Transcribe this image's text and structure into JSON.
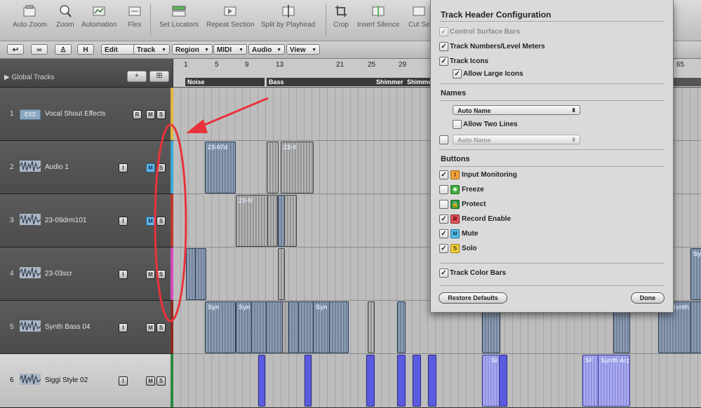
{
  "toolbar": {
    "items": [
      {
        "label": "Auto Zoom",
        "icon": "auto-zoom-icon"
      },
      {
        "label": "Zoom",
        "icon": "zoom-icon"
      },
      {
        "label": "Automation",
        "icon": "automation-icon"
      },
      {
        "label": "Flex",
        "icon": "flex-icon"
      },
      {
        "label": "Set Locators",
        "icon": "set-locators-icon"
      },
      {
        "label": "Repeat Section",
        "icon": "repeat-section-icon"
      },
      {
        "label": "Split by Playhead",
        "icon": "split-playhead-icon"
      },
      {
        "label": "Crop",
        "icon": "crop-icon"
      },
      {
        "label": "Insert Silence",
        "icon": "insert-silence-icon"
      },
      {
        "label": "Cut Se",
        "icon": "cut-section-icon"
      }
    ]
  },
  "menubar": {
    "h_button": "H",
    "menus": [
      "Edit",
      "Track",
      "Region",
      "MIDI",
      "Audio",
      "View"
    ]
  },
  "global_tracks": {
    "label": "Global Tracks",
    "add": "+"
  },
  "ruler": {
    "bars": [
      "1",
      "5",
      "9",
      "13",
      "21",
      "25",
      "29",
      "65"
    ],
    "markers": [
      "Noise",
      "Bass",
      "Shimmer",
      "Shimmer"
    ]
  },
  "tracks": [
    {
      "num": "1",
      "name": "Vocal Shout Effects",
      "icon": "EXS",
      "buttons": [
        "R",
        "M",
        "S"
      ],
      "color": "#e2b83a"
    },
    {
      "num": "2",
      "name": "Audio 1",
      "icon": "waveform",
      "buttons": [
        "I",
        "M",
        "S"
      ],
      "color": "#3aa7d6"
    },
    {
      "num": "3",
      "name": "23-09drm101",
      "icon": "waveform",
      "buttons": [
        "I",
        "M",
        "S"
      ],
      "color": "#c0392b"
    },
    {
      "num": "4",
      "name": "23-03scr",
      "icon": "waveform",
      "buttons": [
        "I",
        "M",
        "S"
      ],
      "color": "#d64bb8"
    },
    {
      "num": "5",
      "name": "Synth Bass 04",
      "icon": "waveform",
      "buttons": [
        "I",
        "M",
        "S"
      ],
      "color": "#8a2b1f"
    },
    {
      "num": "6",
      "name": "Siggi Style 02",
      "icon": "waveform",
      "buttons": [
        "I",
        "M",
        "S"
      ],
      "color": "#2c8a3f"
    }
  ],
  "regions": {
    "r1": "23-07d",
    "r2": "23-0",
    "r3": "23-0!",
    "r4": "Syn",
    "r5": "Syn",
    "r6": "Syn",
    "r7": "Si",
    "r8": "SF",
    "r9": "Synth Arp",
    "r10": "Synth",
    "r11": "Sy"
  },
  "panel": {
    "title": "Track Header Configuration",
    "control_surface_bars": "Control Surface Bars",
    "track_numbers": "Track Numbers/Level Meters",
    "track_icons": "Track Icons",
    "allow_large_icons": "Allow Large Icons",
    "names_title": "Names",
    "name_popup": "Auto Name",
    "allow_two_lines": "Allow Two Lines",
    "name_popup2": "Auto Name",
    "buttons_title": "Buttons",
    "input_monitoring": "Input Monitoring",
    "freeze": "Freeze",
    "protect": "Protect",
    "record_enable": "Record Enable",
    "mute": "Mute",
    "solo": "Solo",
    "track_color_bars": "Track Color Bars",
    "restore_defaults": "Restore Defaults",
    "done": "Done",
    "badges": {
      "input": "I",
      "record": "R",
      "mute": "M",
      "solo": "S"
    },
    "check": "✓"
  },
  "colors": {
    "annotation": "#e8333a",
    "input_badge": "#f0a13a",
    "freeze_badge": "#3fae3f",
    "protect_badge": "#2e9c3a",
    "record_badge": "#e5535a",
    "mute_badge": "#5cc4ee",
    "solo_badge": "#f1d03a"
  }
}
